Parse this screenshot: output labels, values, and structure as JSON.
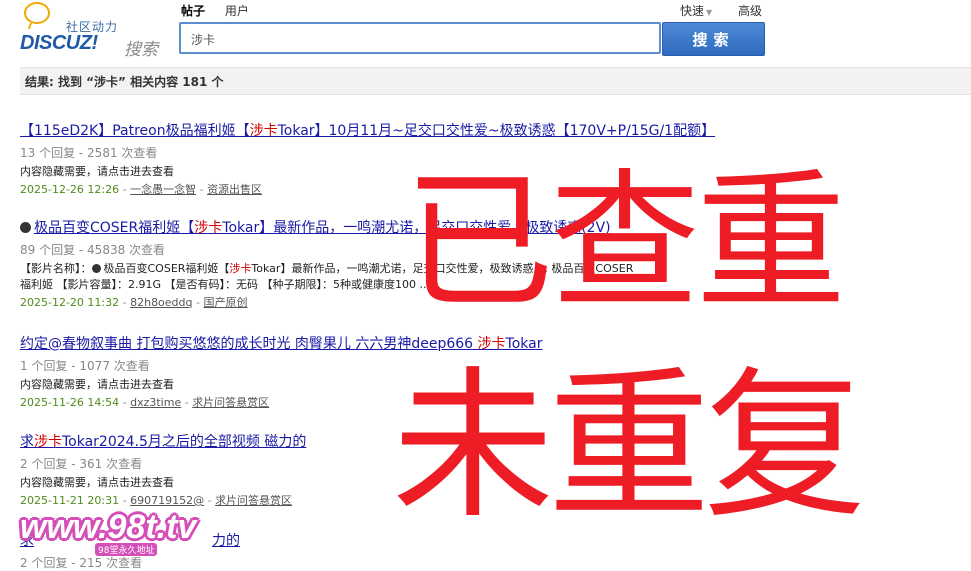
{
  "logo": {
    "community_text": "社区动力",
    "brand": "DISCUZ!",
    "search_word": "搜索"
  },
  "search": {
    "tabs": [
      "帖子",
      "用户"
    ],
    "active_tab": "帖子",
    "quick_label": "快速",
    "advanced_label": "高级",
    "query": "涉卡",
    "button_label": "搜索"
  },
  "result_summary": "结果: 找到 “涉卡” 相关内容 181 个",
  "results": [
    {
      "title_pre": "【115eD2K】Patreon极品福利姬【",
      "title_hl": "涉卡",
      "title_post": "Tokar】10月11月~足交口交性爱~极致诱惑【170V+P/15G/1配额】",
      "stats": "13 个回复 - 2581 次查看",
      "body": "内容隐藏需要，请点击进去查看",
      "date": "2025-12-26 12:26",
      "author": "一念愚一念智",
      "forum": "资源出售区"
    },
    {
      "title_pre": "极品百变COSER福利姬【",
      "title_hl": "涉卡",
      "title_post": "Tokar】最新作品，一鸣潮尤诺，足交口交性爱，极致诱惑(2V)",
      "stats": "89 个回复 - 45838 次查看",
      "body_line1_pre": "【影片名称】：",
      "body_line1_mid": "极品百变COSER福利姬【",
      "body_line1_hl": "涉卡",
      "body_line1_post": "Tokar】最新作品，一鸣潮尤诺，足交口交性爱，极致诱惑 … 极品百变COSER",
      "body_line2": "福利姬 【影片容量】：2.91G 【是否有码】：无码 【种子期限】：5种或健康度100 ...",
      "date": "2025-12-20 11:32",
      "author": "82h8oeddq",
      "forum": "国产原创"
    },
    {
      "title_pre": "约定@春物叙事曲 打包购买悠悠的成长时光 肉臀果儿 六六男神deep666 ",
      "title_hl": "涉卡",
      "title_post": "Tokar",
      "stats": "1 个回复 - 1077 次查看",
      "body": "内容隐藏需要，请点击进去查看",
      "date": "2025-11-26 14:54",
      "author": "dxz3time",
      "forum": "求片问答悬赏区"
    },
    {
      "title_pre": "求",
      "title_hl": "涉卡",
      "title_post": "Tokar2024.5月之后的全部视频 磁力的",
      "stats": "2 个回复 - 361 次查看",
      "body": "内容隐藏需要，请点击进去查看",
      "date": "2025-11-21 20:31",
      "author": "690719152@",
      "forum": "求片问答悬赏区"
    },
    {
      "title_pre": "求",
      "title_post": "力的",
      "stats": "2 个回复 - 215 次查看"
    }
  ],
  "overlay": {
    "stamp_top": "已查重",
    "stamp_bottom": "未重复",
    "watermark": "www.98t.tv",
    "watermark_sub": "98堂永久地址"
  },
  "colors": {
    "link": "#1a1aa6",
    "highlight": "#d40000",
    "stamp": "#ee1c25",
    "date": "#4f8b1a",
    "button": "#2e6bc0"
  }
}
